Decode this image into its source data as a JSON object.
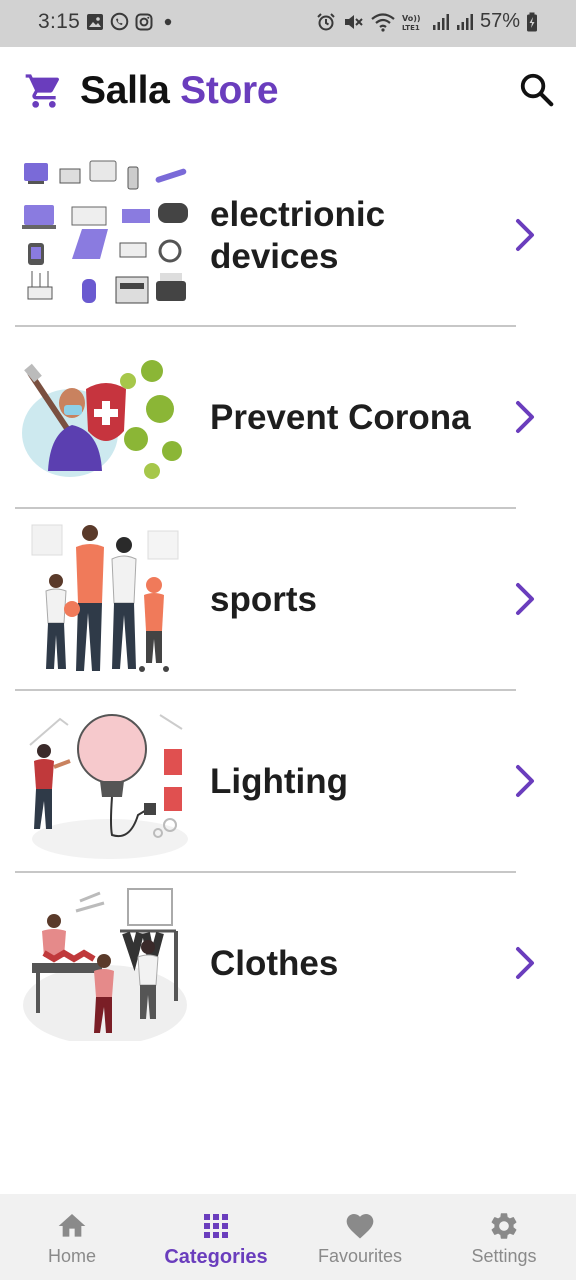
{
  "status_bar": {
    "time": "3:15",
    "battery": "57%"
  },
  "app_bar": {
    "title_part1": "Salla",
    "title_part2": "Store",
    "accent_color": "#6a3dbd"
  },
  "categories": [
    {
      "label": "electrionic devices",
      "image": "electronics-illustration"
    },
    {
      "label": "Prevent Corona",
      "image": "corona-shield-illustration"
    },
    {
      "label": "sports",
      "image": "family-sports-illustration"
    },
    {
      "label": "Lighting",
      "image": "lightbulb-illustration"
    },
    {
      "label": "Clothes",
      "image": "clothes-shop-illustration"
    }
  ],
  "bottom_nav": {
    "items": [
      {
        "label": "Home",
        "icon": "home-icon"
      },
      {
        "label": "Categories",
        "icon": "grid-icon"
      },
      {
        "label": "Favourites",
        "icon": "heart-icon"
      },
      {
        "label": "Settings",
        "icon": "gear-icon"
      }
    ],
    "active": "Categories"
  }
}
